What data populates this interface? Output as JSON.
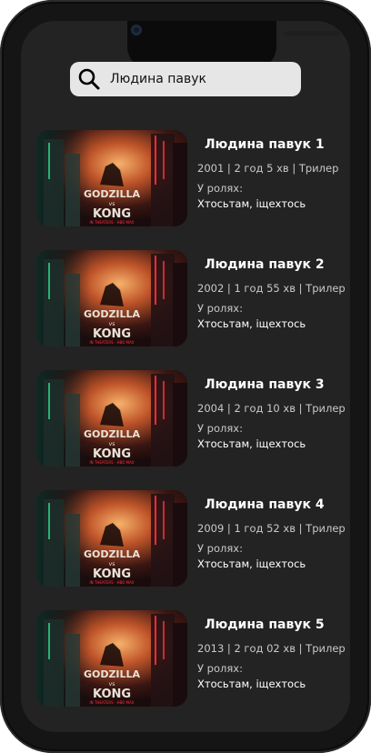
{
  "search": {
    "value": "Людина павук"
  },
  "poster": {
    "line1": "GODZILLA",
    "vs": "vs",
    "line2": "KONG",
    "credit": "IN THEATERS · HBO MAX"
  },
  "cast_label": "У ролях:",
  "movies": [
    {
      "title": "Людина павук 1",
      "meta": "2001 | 2 год 5 хв | Трилер",
      "cast": "Хтосьтам, іщехтось"
    },
    {
      "title": "Людина павук 2",
      "meta": "2002 | 1 год 55 хв | Трилер",
      "cast": "Хтосьтам, іщехтось"
    },
    {
      "title": "Людина павук 3",
      "meta": "2004 | 2 год 10 хв | Трилер",
      "cast": "Хтосьтам, іщехтось"
    },
    {
      "title": "Людина павук 4",
      "meta": "2009 | 1 год 52 хв | Трилер",
      "cast": "Хтосьтам, іщехтось"
    },
    {
      "title": "Людина павук 5",
      "meta": "2013 | 2 год 02 хв | Трилер",
      "cast": "Хтосьтам, іщехтось"
    }
  ]
}
